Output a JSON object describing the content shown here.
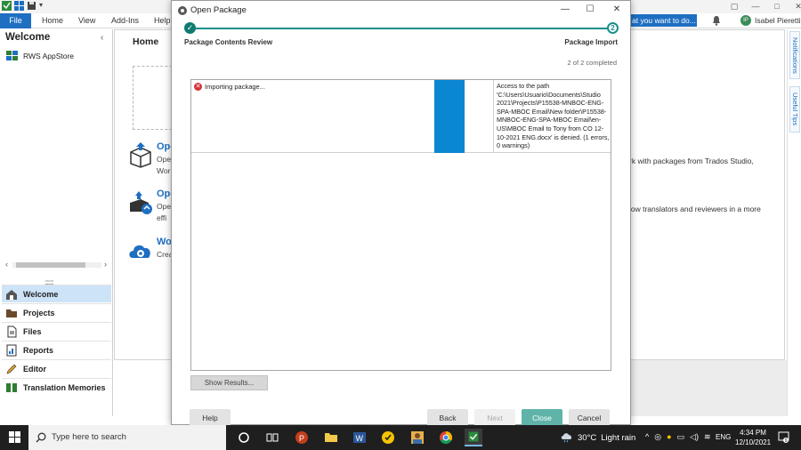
{
  "app": {
    "ribbon_tabs": [
      "File",
      "Home",
      "View",
      "Add-Ins",
      "Help"
    ],
    "tell_me": "at you want to do...",
    "user_initials": "IP",
    "user_name": "Isabel Pieretti"
  },
  "nav": {
    "title": "Welcome",
    "appstore_label": "RWS AppStore",
    "items": [
      {
        "label": "Welcome"
      },
      {
        "label": "Projects"
      },
      {
        "label": "Files"
      },
      {
        "label": "Reports"
      },
      {
        "label": "Editor"
      },
      {
        "label": "Translation Memories"
      }
    ]
  },
  "home": {
    "title": "Home",
    "rows": [
      {
        "heading": "Ope",
        "line1": "Ope",
        "line2": "Wor"
      },
      {
        "heading": "Ope",
        "line1": "Ope",
        "line2": "effi"
      },
      {
        "heading": "Wo",
        "line1": "Crea",
        "line2": ""
      }
    ],
    "right_text_1": "rk with packages from Trados Studio,",
    "right_text_2": "low translators and reviewers in a more"
  },
  "side_tabs": {
    "notifications": "Notifications",
    "useful_tips": "Useful Tips"
  },
  "dialog": {
    "title": "Open Package",
    "step1_label": "Package Contents Review",
    "step2_label": "Package Import",
    "step2_number": "2",
    "progress": "2 of 2 completed",
    "result_status": "Importing package...",
    "result_message": "Access to the path 'C:\\Users\\Usuario\\Documents\\Studio 2021\\Projects\\P15538-MNBOC-ENG-SPA-MBOC Email\\New folder\\P15538-MNBOC-ENG-SPA-MBOC Email\\en-US\\MBOC Email to Tony from CO 12-10-2021 ENG.docx' is denied. (1 errors, 0 warnings)",
    "show_results": "Show Results...",
    "buttons": {
      "help": "Help",
      "back": "Back",
      "next": "Next",
      "close": "Close",
      "cancel": "Cancel"
    }
  },
  "taskbar": {
    "search_placeholder": "Type here to search",
    "temperature": "30°C",
    "weather": "Light rain",
    "language": "ENG",
    "time": "4:34 PM",
    "date": "12/10/2021",
    "notification_count": "9"
  },
  "colors": {
    "accent": "#1e6fc2",
    "teal": "#1a8f8a",
    "progress_fill": "#0b86d1",
    "error": "#d13438"
  }
}
